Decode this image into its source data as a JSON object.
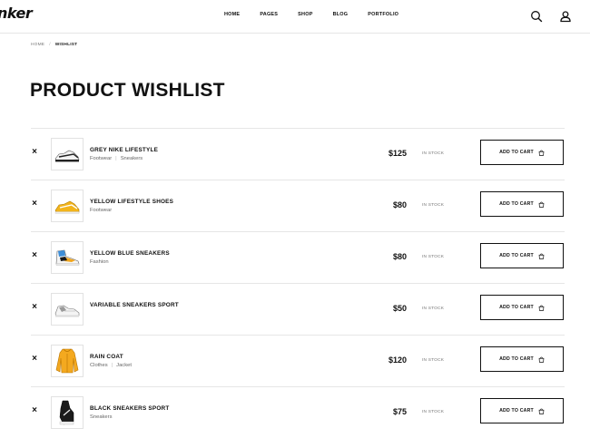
{
  "header": {
    "logo": "nker",
    "nav": [
      "HOME",
      "PAGES",
      "SHOP",
      "BLOG",
      "PORTFOLIO"
    ],
    "icons": [
      "search-icon",
      "user-icon"
    ]
  },
  "breadcrumb": {
    "home": "HOME",
    "sep": "/",
    "current": "WISHLIST"
  },
  "page_title": "PRODUCT WISHLIST",
  "wishlist": {
    "remove_glyph": "×",
    "add_to_cart_label": "ADD TO CART",
    "items": [
      {
        "name": "GREY NIKE LIFESTYLE",
        "categories": [
          "Footwear",
          "Sneakers"
        ],
        "price": "$125",
        "stock": "IN STOCK",
        "image": "grey-sneaker"
      },
      {
        "name": "YELLOW LIFESTYLE SHOES",
        "categories": [
          "Footwear"
        ],
        "price": "$80",
        "stock": "IN STOCK",
        "image": "yellow-sneaker"
      },
      {
        "name": "YELLOW BLUE SNEAKERS",
        "categories": [
          "Fashion"
        ],
        "price": "$80",
        "stock": "IN STOCK",
        "image": "blue-sneaker"
      },
      {
        "name": "VARIABLE SNEAKERS SPORT",
        "categories": [],
        "price": "$50",
        "stock": "IN STOCK",
        "image": "white-sneaker"
      },
      {
        "name": "RAIN COAT",
        "categories": [
          "Clothes",
          "Jacket"
        ],
        "price": "$120",
        "stock": "IN STOCK",
        "image": "yellow-coat"
      },
      {
        "name": "BLACK SNEAKERS SPORT",
        "categories": [
          "Sneakers"
        ],
        "price": "$75",
        "stock": "IN STOCK",
        "image": "black-sneaker"
      }
    ]
  }
}
